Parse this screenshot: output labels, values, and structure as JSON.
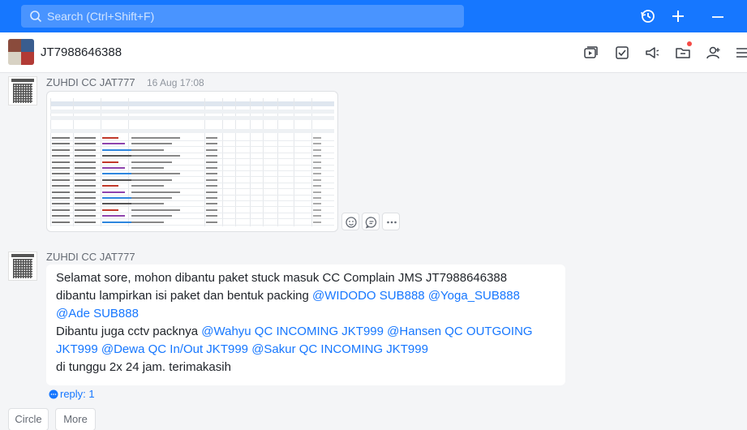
{
  "search": {
    "placeholder": "Search (Ctrl+Shift+F)"
  },
  "topbar": {
    "icons": [
      "history-icon",
      "plus-icon",
      "minimize-icon"
    ]
  },
  "chat": {
    "title": "JT7988646388",
    "header_icons": [
      "screen-share-icon",
      "checklist-icon",
      "announcement-icon",
      "folder-icon",
      "add-member-icon",
      "settings-icon"
    ]
  },
  "messages": [
    {
      "sender": "ZUHDI CC JAT777",
      "time": "16 Aug 17:08",
      "type": "image"
    },
    {
      "sender": "ZUHDI CC JAT777",
      "lines": [
        [
          {
            "t": "Selamat sore, mohon dibantu paket stuck masuk CC Complain JMS JT7988646388"
          }
        ],
        [
          {
            "t": "dibantu lampirkan isi paket dan  bentuk packing "
          },
          {
            "t": "@WIDODO SUB888",
            "m": true
          },
          {
            "t": " "
          },
          {
            "t": "@Yoga_SUB888",
            "m": true
          }
        ],
        [
          {
            "t": "@Ade SUB888",
            "m": true
          }
        ],
        [
          {
            "t": "Dibantu juga cctv packnya "
          },
          {
            "t": "@Wahyu QC INCOMING JKT999",
            "m": true
          },
          {
            "t": " "
          },
          {
            "t": "@Hansen QC OUTGOING",
            "m": true
          }
        ],
        [
          {
            "t": "JKT999",
            "m": true
          },
          {
            "t": " "
          },
          {
            "t": "@Dewa QC In/Out JKT999",
            "m": true
          },
          {
            "t": " "
          },
          {
            "t": "@Sakur QC INCOMING JKT999",
            "m": true
          }
        ],
        [
          {
            "t": "di tunggu 2x 24 jam. terimakasih"
          }
        ]
      ],
      "reply_label": "reply: 1"
    }
  ],
  "footer": {
    "buttons": [
      "Circle",
      "More"
    ]
  },
  "colors": {
    "accent": "#1677ff",
    "mention": "#1677ff",
    "badge": "#f54a45"
  }
}
